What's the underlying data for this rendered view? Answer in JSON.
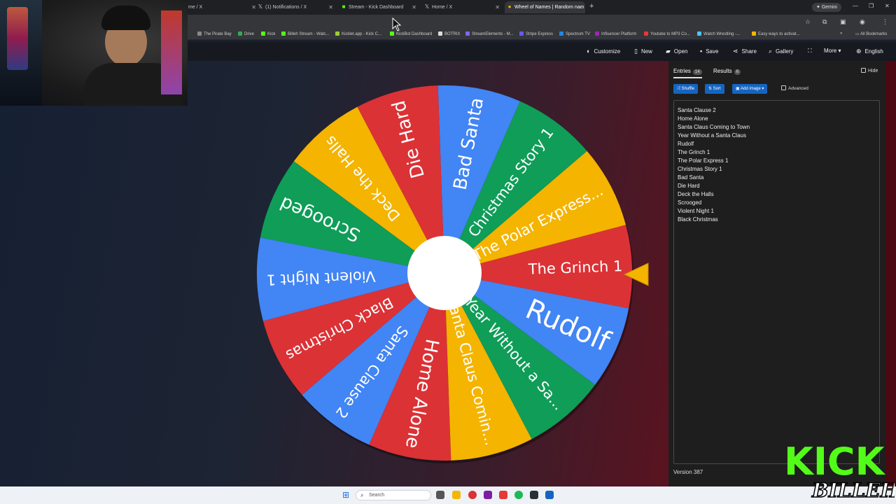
{
  "browser": {
    "tabs": [
      {
        "label": "me / X",
        "icon": "x-icon"
      },
      {
        "label": "(1) Notifications / X",
        "icon": "x-icon"
      },
      {
        "label": "Stream - Kick Dashboard",
        "icon": "kick-icon"
      },
      {
        "label": "Home / X",
        "icon": "x-icon"
      },
      {
        "label": "Wheel of Names | Random nam",
        "icon": "wheel-icon",
        "active": true
      }
    ],
    "gemini_label": "Gemini",
    "bookmarks": [
      "The Pirate Bay",
      "Drive",
      "Kick",
      "Billeh Stream - Watc...",
      "Kicklet.app - Kick C...",
      "KickBot Dashboard",
      "BOTRIX",
      "StreamElements - M...",
      "Stripe Express",
      "Spectrum TV",
      "Influencer Platform",
      "Youtube to MP3 Co...",
      "Watch Wrestling -...",
      "Easy ways to activat..."
    ],
    "all_bookmarks_label": "All Bookmarks"
  },
  "toolbar": {
    "customize": "Customize",
    "new": "New",
    "open": "Open",
    "save": "Save",
    "share": "Share",
    "gallery": "Gallery",
    "more": "More",
    "language": "English"
  },
  "wheel": {
    "slices": [
      {
        "label": "The Polar Express...",
        "color": "#f4b400"
      },
      {
        "label": "Christmas Story 1",
        "color": "#0f9d58"
      },
      {
        "label": "Bad Santa",
        "color": "#4285f4"
      },
      {
        "label": "Die Hard",
        "color": "#db3236"
      },
      {
        "label": "Deck the Halls",
        "color": "#f4b400"
      },
      {
        "label": "Scrooged",
        "color": "#0f9d58"
      },
      {
        "label": "Violent Night 1",
        "color": "#4285f4"
      },
      {
        "label": "Black Christmas",
        "color": "#db3236"
      },
      {
        "label": "Santa Clause 2",
        "color": "#4285f4"
      },
      {
        "label": "Home Alone",
        "color": "#db3236"
      },
      {
        "label": "Santa Claus Comin...",
        "color": "#f4b400"
      },
      {
        "label": "Year Without a Sa...",
        "color": "#0f9d58"
      },
      {
        "label": "Rudolf",
        "color": "#4285f4"
      },
      {
        "label": "The Grinch 1",
        "color": "#db3236"
      }
    ]
  },
  "panel": {
    "entries_tab": "Entries",
    "entries_count": "14",
    "results_tab": "Results",
    "results_count": "6",
    "hide_label": "Hide",
    "shuffle_label": "Shuffle",
    "sort_label": "Sort",
    "add_image_label": "Add image",
    "advanced_label": "Advanced",
    "entries": [
      "Santa Clause 2",
      "Home Alone",
      "Santa Claus Coming to Town",
      "Year Without a Santa Claus",
      "Rudolf",
      "The Grinch 1",
      "The Polar Express 1",
      "Christmas Story 1",
      "Bad Santa",
      "Die Hard",
      "Deck the Halls",
      "Scrooged",
      "Violent Night 1",
      "Black Christmas"
    ],
    "version": "Version 387"
  },
  "taskbar": {
    "search_placeholder": "Search"
  },
  "overlay": {
    "logo_text_1": "KICK",
    "logo_text_2": "BILLEH"
  }
}
